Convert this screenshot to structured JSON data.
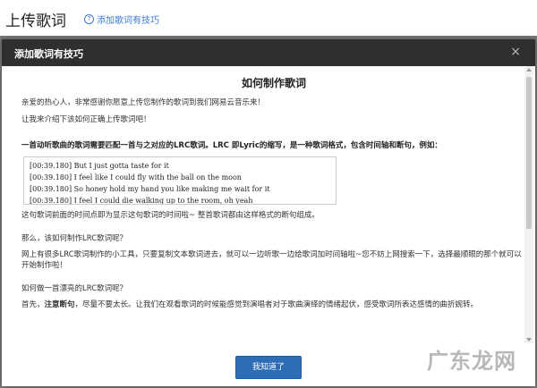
{
  "page": {
    "title": "上传歌词",
    "help_link": "添加歌词有技巧"
  },
  "modal": {
    "title": "添加歌词有技巧",
    "close": "×",
    "heading": "如何制作歌词",
    "intro_1": "亲爱的热心人，非常感谢你愿意上传您制作的歌词到我们网易云音乐来！",
    "intro_2": "让我来介绍下该如何正确上传歌词吧！",
    "definition": "一首动听歌曲的歌词需要匹配一首与之对应的LRC歌词。LRC 即Lyric的缩写，是一种歌词格式，包含时间轴和断句，例如：",
    "lrc_lines": [
      "[00:39.180] But I just gotta taste for it",
      "[00:39.180] I feel like I could fly with the ball on the moon",
      "[00:39.180] So honey hold my hand you like making me wait for it",
      "[00:39.180] I feel I could die walking up to the room, oh yeah"
    ],
    "lrc_note": "这句歌词前面的时间点即为显示这句歌词的时间啦~ 整首歌词都由这样格式的断句组成。",
    "q1": "那么，该如何制作LRC歌词呢？",
    "a1": "网上有很多LRC歌词制作的小工具，只要复制文本歌词进去，就可以一边听歌一边给歌词加时间轴啦~您不妨上网搜索一下，选择最顺眼的那个就可以开始制作啦！",
    "q2": "如何做一首漂亮的LRC歌词呢？",
    "a2_prefix": "首先，",
    "a2_bold": "注意断句",
    "a2_rest": "，尽量不要太长。让我们在观看歌词的时候能感觉到演唱者对于歌曲演绎的情绪起伏，感受歌词所表达感情的曲折婉转。",
    "ok_button": "我知道了"
  },
  "watermark": "广东龙网"
}
